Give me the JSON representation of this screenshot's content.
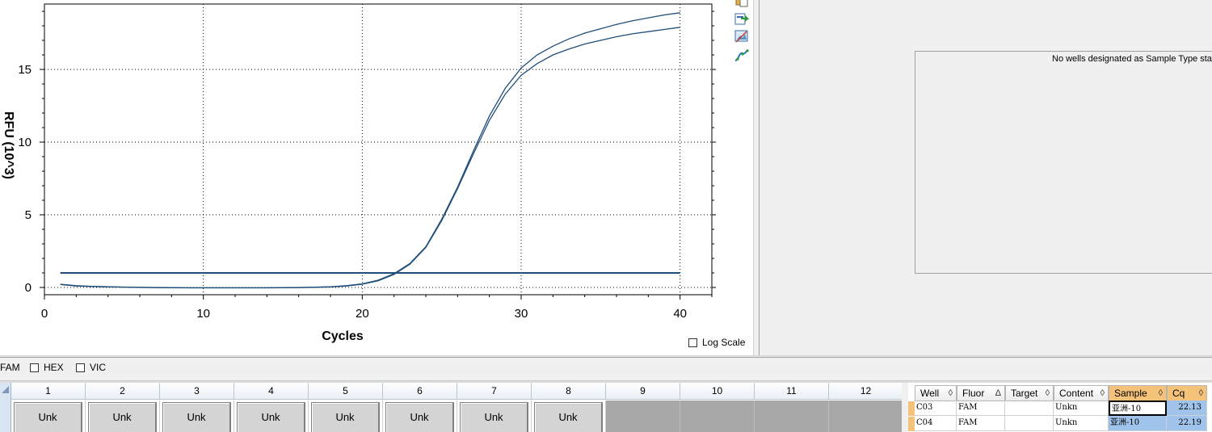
{
  "chart_data": {
    "type": "line",
    "xlabel": "Cycles",
    "ylabel": "RFU (10^3)",
    "xlim": [
      0,
      42
    ],
    "ylim": [
      -0.5,
      19.5
    ],
    "xticks": [
      0,
      10,
      20,
      30,
      40
    ],
    "yticks": [
      0,
      5,
      10,
      15
    ],
    "grid": true,
    "threshold": 1.0,
    "series": [
      {
        "x": [
          1,
          2,
          3,
          4,
          5,
          6,
          7,
          8,
          9,
          10,
          11,
          12,
          13,
          14,
          15,
          16,
          17,
          18,
          19,
          20,
          21,
          22,
          23,
          24,
          25,
          26,
          27,
          28,
          29,
          30,
          31,
          32,
          33,
          34,
          35,
          36,
          37,
          38,
          39,
          40
        ],
        "values": [
          0.22,
          0.12,
          0.08,
          0.05,
          0.03,
          0.01,
          0.0,
          -0.01,
          -0.02,
          -0.02,
          -0.02,
          -0.02,
          -0.02,
          -0.02,
          -0.01,
          0.0,
          0.02,
          0.05,
          0.12,
          0.25,
          0.5,
          0.95,
          1.65,
          2.8,
          4.7,
          6.9,
          9.4,
          11.8,
          13.7,
          15.1,
          16.0,
          16.6,
          17.1,
          17.5,
          17.8,
          18.1,
          18.35,
          18.55,
          18.75,
          18.9
        ]
      },
      {
        "x": [
          1,
          2,
          3,
          4,
          5,
          6,
          7,
          8,
          9,
          10,
          11,
          12,
          13,
          14,
          15,
          16,
          17,
          18,
          19,
          20,
          21,
          22,
          23,
          24,
          25,
          26,
          27,
          28,
          29,
          30,
          31,
          32,
          33,
          34,
          35,
          36,
          37,
          38,
          39,
          40
        ],
        "values": [
          0.2,
          0.1,
          0.06,
          0.04,
          0.02,
          0.0,
          -0.01,
          -0.02,
          -0.03,
          -0.03,
          -0.03,
          -0.03,
          -0.03,
          -0.03,
          -0.02,
          -0.01,
          0.01,
          0.04,
          0.1,
          0.22,
          0.46,
          0.9,
          1.6,
          2.75,
          4.6,
          6.8,
          9.2,
          11.5,
          13.3,
          14.6,
          15.4,
          16.0,
          16.4,
          16.75,
          17.0,
          17.25,
          17.45,
          17.6,
          17.75,
          17.9
        ]
      }
    ],
    "line_color": "#1f4e79"
  },
  "log_scale_label": "Log Scale",
  "standard_curve_message": "No wells designated as Sample Type standard",
  "fluors": [
    {
      "label": "FAM"
    },
    {
      "label": "HEX"
    },
    {
      "label": "VIC"
    }
  ],
  "plate": {
    "columns": [
      "1",
      "2",
      "3",
      "4",
      "5",
      "6",
      "7",
      "8",
      "9",
      "10",
      "11",
      "12"
    ],
    "wells": [
      "Unk",
      "Unk",
      "Unk",
      "Unk",
      "Unk",
      "Unk",
      "Unk",
      "Unk",
      "",
      "",
      "",
      ""
    ]
  },
  "table": {
    "headers": [
      {
        "label": "Well",
        "sort": "◊"
      },
      {
        "label": "Fluor",
        "sort": "Δ"
      },
      {
        "label": "Target",
        "sort": "◊"
      },
      {
        "label": "Content",
        "sort": "◊"
      },
      {
        "label": "Sample",
        "sort": "◊"
      },
      {
        "label": "Cq",
        "sort": "◊"
      }
    ],
    "rows": [
      [
        "C03",
        "FAM",
        "",
        "Unkn",
        "亚洲-10",
        "22.13"
      ],
      [
        "C04",
        "FAM",
        "",
        "Unkn",
        "亚洲-10",
        "22.19"
      ]
    ]
  },
  "icons": [
    "copy-chart-icon",
    "export-icon",
    "image-icon",
    "curve-icon"
  ],
  "colors": {
    "accent_orange": "#f5c27a",
    "selection_blue": "#9fc3ea",
    "empty_well": "#a8a8a8"
  }
}
